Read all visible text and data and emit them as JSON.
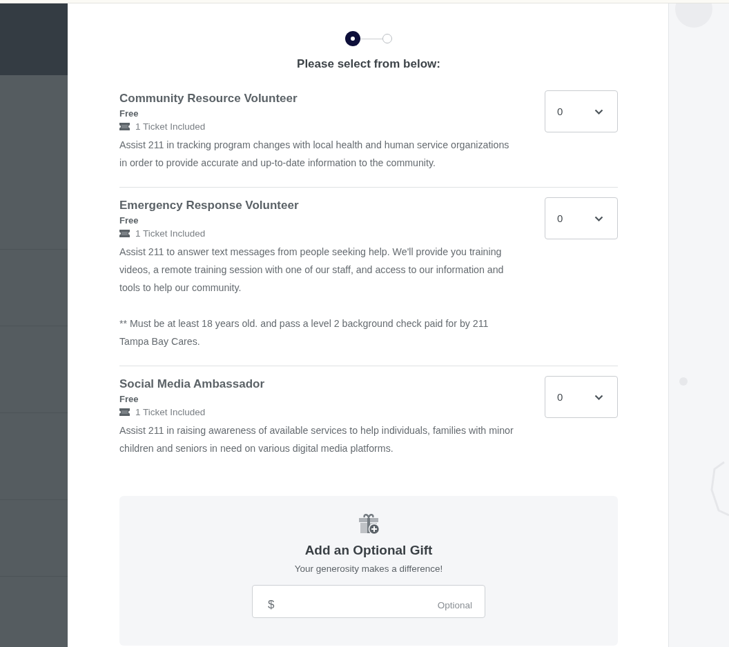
{
  "stepper": {
    "steps": [
      {
        "selected": true
      },
      {
        "selected": false
      }
    ]
  },
  "heading": "Please select from below:",
  "tickets": [
    {
      "title": "Community Resource Volunteer",
      "price": "Free",
      "included": "1 Ticket Included",
      "description": [
        "Assist 211 in tracking program changes with local health and human service organizations in order to provide accurate and up-to-date information to the community."
      ],
      "quantity": "0"
    },
    {
      "title": "Emergency Response Volunteer",
      "price": "Free",
      "included": "1 Ticket Included",
      "description": [
        "Assist 211 to answer text messages from people seeking help. We'll provide you training videos, a remote training session with one of our staff, and access to our information and tools to help our community.",
        "** Must be at least 18 years old. and pass a level 2 background check paid for by 211 Tampa Bay Cares."
      ],
      "quantity": "0"
    },
    {
      "title": "Social Media Ambassador",
      "price": "Free",
      "included": "1 Ticket Included",
      "description": [
        "Assist 211 in raising awareness of available services to help individuals, families with minor children and seniors in need on various digital media platforms."
      ],
      "quantity": "0"
    }
  ],
  "gift": {
    "title": "Add an Optional Gift",
    "subtitle": "Your generosity makes a difference!",
    "currency": "$",
    "placeholder": "Optional"
  }
}
